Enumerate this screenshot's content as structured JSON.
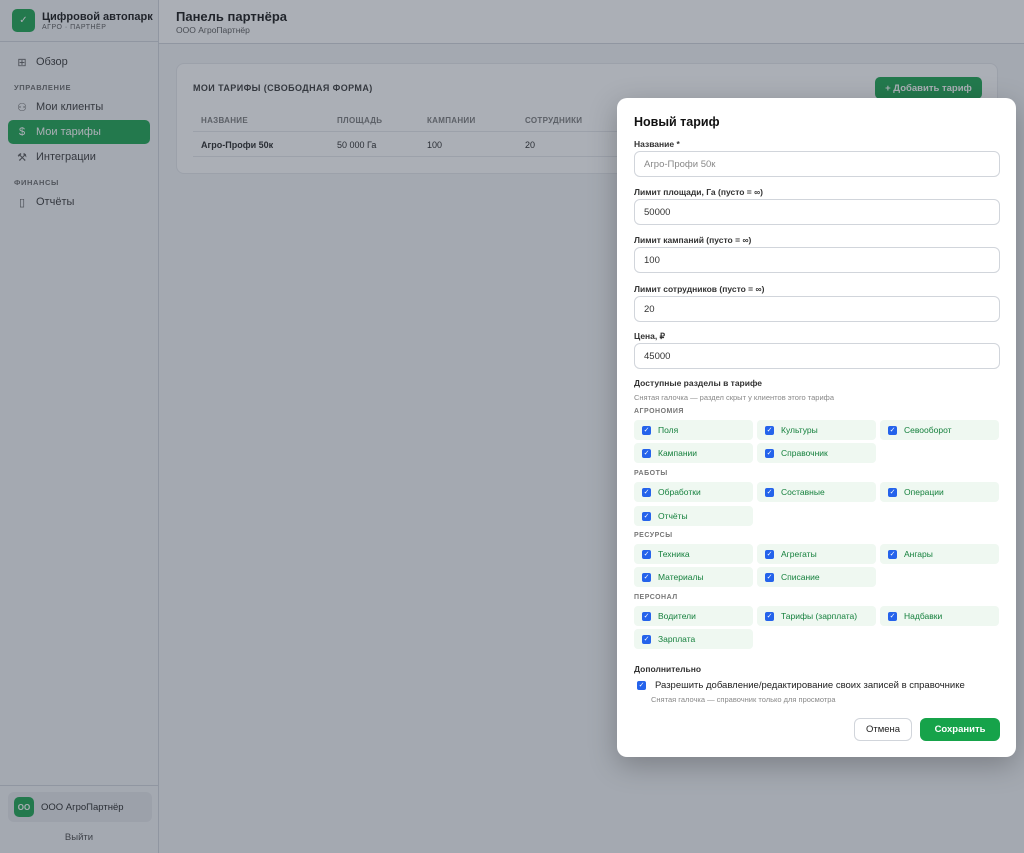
{
  "app": {
    "title": "Цифровой автопарк",
    "subtitle": "АГРО · ПАРТНЁР"
  },
  "sidebar": {
    "overview": "Обзор",
    "section_manage": "УПРАВЛЕНИЕ",
    "clients": "Мои клиенты",
    "tariffs": "Мои тарифы",
    "integrations": "Интеграции",
    "section_finance": "ФИНАНСЫ",
    "reports": "Отчёты",
    "org_initials": "ОО",
    "org_name": "ООО АгроПартнёр",
    "logout": "Выйти"
  },
  "header": {
    "title": "Панель партнёра",
    "subtitle": "ООО АгроПартнёр"
  },
  "card": {
    "title": "МОИ ТАРИФЫ (СВОБОДНАЯ ФОРМА)",
    "add_button": "+ Добавить тариф",
    "columns": [
      "НАЗВАНИЕ",
      "ПЛОЩАДЬ",
      "КАМПАНИИ",
      "СОТРУДНИКИ"
    ],
    "row": {
      "name": "Агро-Профи 50к",
      "area": "50 000 Га",
      "campaigns": "100",
      "staff": "20"
    }
  },
  "modal": {
    "title": "Новый тариф",
    "name_label": "Название *",
    "name_placeholder": "Агро-Профи 50к",
    "area_label": "Лимит площади, Га (пусто = ∞)",
    "area_value": "50000",
    "campaigns_label": "Лимит кампаний (пусто = ∞)",
    "campaigns_value": "100",
    "staff_label": "Лимит сотрудников (пусто = ∞)",
    "staff_value": "20",
    "price_label": "Цена, ₽",
    "price_value": "45000",
    "sections_label": "Доступные разделы в тарифе",
    "sections_hint": "Снятая галочка — раздел скрыт у клиентов этого тарифа",
    "groups": {
      "agronomy": {
        "title": "АГРОНОМИЯ",
        "items": [
          "Поля",
          "Культуры",
          "Севооборот",
          "Кампании",
          "Справочник"
        ]
      },
      "works": {
        "title": "РАБОТЫ",
        "items": [
          "Обработки",
          "Составные",
          "Операции",
          "Отчёты"
        ]
      },
      "resources": {
        "title": "РЕСУРСЫ",
        "items": [
          "Техника",
          "Агрегаты",
          "Ангары",
          "Материалы",
          "Списание"
        ]
      },
      "personnel": {
        "title": "ПЕРСОНАЛ",
        "items": [
          "Водители",
          "Тарифы (зарплата)",
          "Надбавки",
          "Зарплата"
        ]
      }
    },
    "extra_label": "Дополнительно",
    "extra_checkbox": "Разрешить добавление/редактирование своих записей в справочнике",
    "extra_hint": "Снятая галочка — справочник только для просмотра",
    "cancel": "Отмена",
    "save": "Сохранить"
  },
  "colors": {
    "accent": "#16a34a",
    "checkbox": "#2563eb",
    "chip_bg": "#eff8f1"
  }
}
